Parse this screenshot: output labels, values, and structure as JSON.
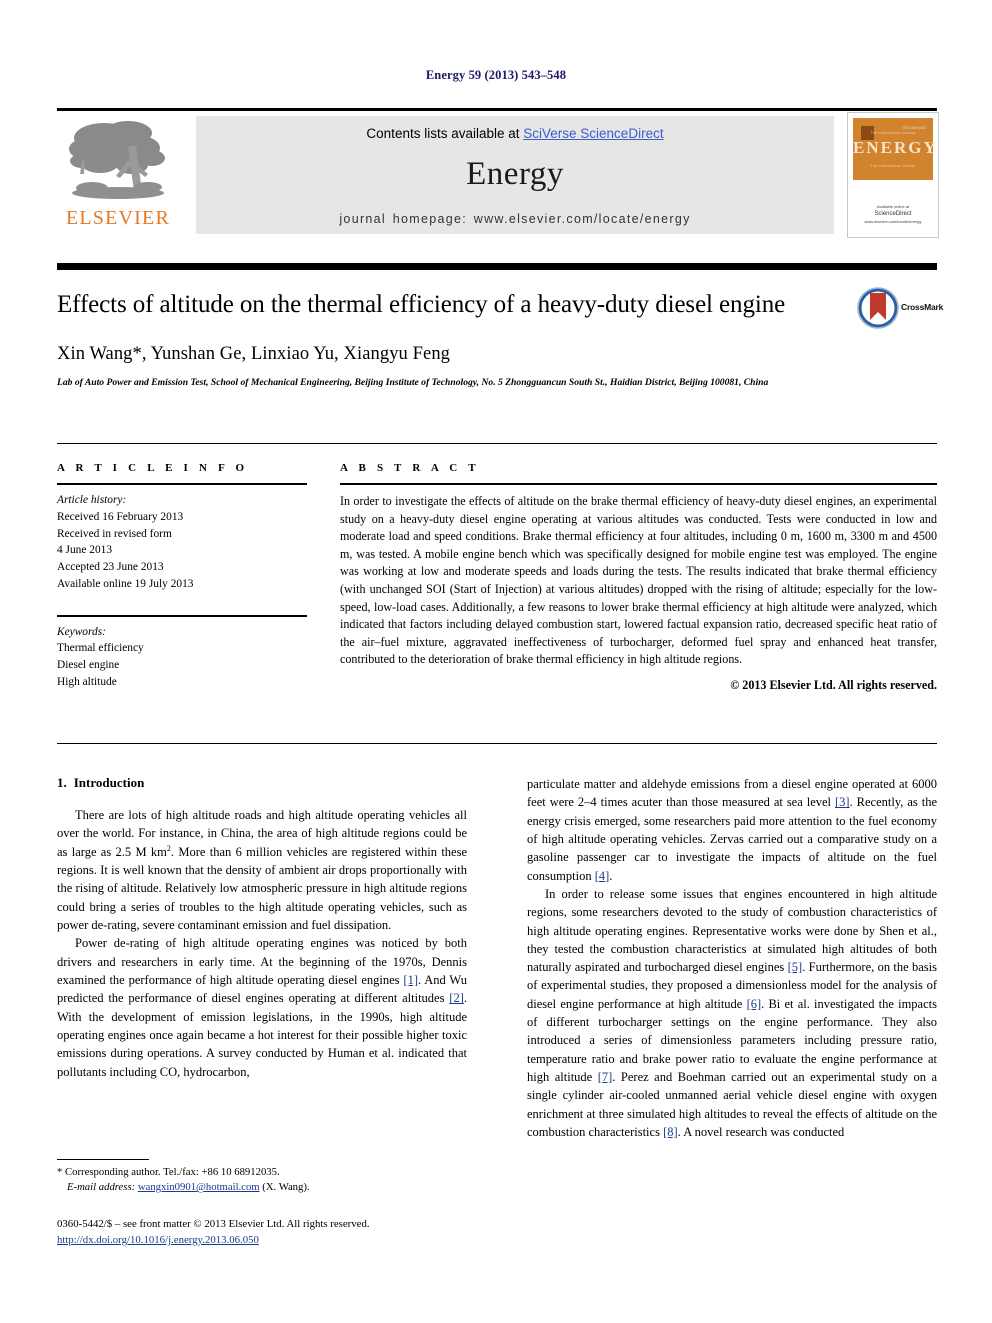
{
  "running_head": "Energy 59 (2013) 543–548",
  "masthead": {
    "contents_prefix": "Contents lists available at ",
    "sciencedirect": "SciVerse ScienceDirect",
    "journal_name": "Energy",
    "homepage": "journal homepage: www.elsevier.com/locate/energy",
    "publisher": "ELSEVIER",
    "publisher_color": "#E87722",
    "link_color": "#3a5fcd",
    "cover": {
      "band_title": "ENERGY",
      "band_color": "#d2832d",
      "issn_micro": "ISSN 0360-5442",
      "top_micro": "The International Journal",
      "footer_small": "Available online at",
      "footer_brand": "ScienceDirect",
      "footer_sub": "www.elsevier.com/locate/energy"
    }
  },
  "article": {
    "title": "Effects of altitude on the thermal efficiency of a heavy-duty diesel engine",
    "authors": "Xin Wang*, Yunshan Ge, Linxiao Yu, Xiangyu Feng",
    "affiliation": "Lab of Auto Power and Emission Test, School of Mechanical Engineering, Beijing Institute of Technology, No. 5 Zhongguancun South St., Haidian District, Beijing 100081, China",
    "crossmark_label": "CrossMark"
  },
  "info": {
    "heading": "A R T I C L E   I N F O",
    "history_label": "Article history:",
    "history": [
      "Received 16 February 2013",
      "Received in revised form",
      "4 June 2013",
      "Accepted 23 June 2013",
      "Available online 19 July 2013"
    ],
    "keywords_label": "Keywords:",
    "keywords": [
      "Thermal efficiency",
      "Diesel engine",
      "High altitude"
    ]
  },
  "abstract": {
    "heading": "A B S T R A C T",
    "text": "In order to investigate the effects of altitude on the brake thermal efficiency of heavy-duty diesel engines, an experimental study on a heavy-duty diesel engine operating at various altitudes was conducted. Tests were conducted in low and moderate load and speed conditions. Brake thermal efficiency at four altitudes, including 0 m, 1600 m, 3300 m and 4500 m, was tested. A mobile engine bench which was specifically designed for mobile engine test was employed. The engine was working at low and moderate speeds and loads during the tests. The results indicated that brake thermal efficiency (with unchanged SOI (Start of Injection) at various altitudes) dropped with the rising of altitude; especially for the low-speed, low-load cases. Additionally, a few reasons to lower brake thermal efficiency at high altitude were analyzed, which indicated that factors including delayed combustion start, lowered factual expansion ratio, decreased specific heat ratio of the air–fuel mixture, aggravated ineffectiveness of turbocharger, deformed fuel spray and enhanced heat transfer, contributed to the deterioration of brake thermal efficiency in high altitude regions.",
    "copyright": "© 2013 Elsevier Ltd. All rights reserved."
  },
  "section": {
    "number": "1.",
    "title": "Introduction"
  },
  "left_column": {
    "p1": "There are lots of high altitude roads and high altitude operating vehicles all over the world. For instance, in China, the area of high altitude regions could be as large as 2.5 M km2. More than 6 million vehicles are registered within these regions. It is well known that the density of ambient air drops proportionally with the rising of altitude. Relatively low atmospheric pressure in high altitude regions could bring a series of troubles to the high altitude operating vehicles, such as power de-rating, severe contaminant emission and fuel dissipation.",
    "p2_a": "Power de-rating of high altitude operating engines was noticed by both drivers and researchers in early time. At the beginning of the 1970s, Dennis examined the performance of high altitude operating diesel engines ",
    "p2_c1": "[1]",
    "p2_b": ". And Wu predicted the performance of diesel engines operating at different altitudes ",
    "p2_c2": "[2]",
    "p2_d": ". With the development of emission legislations, in the 1990s, high altitude operating engines once again became a hot interest for their possible higher toxic emissions during operations. A survey conducted by Human et al. indicated that pollutants including CO, hydrocarbon,"
  },
  "right_column": {
    "p1_a": "particulate matter and aldehyde emissions from a diesel engine operated at 6000 feet were 2–4 times acuter than those measured at sea level ",
    "p1_c1": "[3]",
    "p1_b": ". Recently, as the energy crisis emerged, some researchers paid more attention to the fuel economy of high altitude operating vehicles. Zervas carried out a comparative study on a gasoline passenger car to investigate the impacts of altitude on the fuel consumption ",
    "p1_c2": "[4]",
    "p1_c": ".",
    "p2_a": "In order to release some issues that engines encountered in high altitude regions, some researchers devoted to the study of combustion characteristics of high altitude operating engines. Representative works were done by Shen et al., they tested the combustion characteristics at simulated high altitudes of both naturally aspirated and turbocharged diesel engines ",
    "p2_c1": "[5]",
    "p2_b": ". Furthermore, on the basis of experimental studies, they proposed a dimensionless model for the analysis of diesel engine performance at high altitude ",
    "p2_c2": "[6]",
    "p2_c": ". Bi et al. investigated the impacts of different turbocharger settings on the engine performance. They also introduced a series of dimensionless parameters including pressure ratio, temperature ratio and brake power ratio to evaluate the engine performance at high altitude ",
    "p2_c3": "[7]",
    "p2_d": ". Perez and Boehman carried out an experimental study on a single cylinder air-cooled unmanned aerial vehicle diesel engine with oxygen enrichment at three simulated high altitudes to reveal the effects of altitude on the combustion characteristics ",
    "p2_c4": "[8]",
    "p2_e": ". A novel research was conducted"
  },
  "footnote": {
    "corresponding": "* Corresponding author. Tel./fax: +86 10 68912035.",
    "email_label": "E-mail address:",
    "email": "wangxin0901@hotmail.com",
    "email_suffix": " (X. Wang)."
  },
  "imprint": {
    "line1": "0360-5442/$ – see front matter © 2013 Elsevier Ltd. All rights reserved.",
    "doi": "http://dx.doi.org/10.1016/j.energy.2013.06.050"
  }
}
